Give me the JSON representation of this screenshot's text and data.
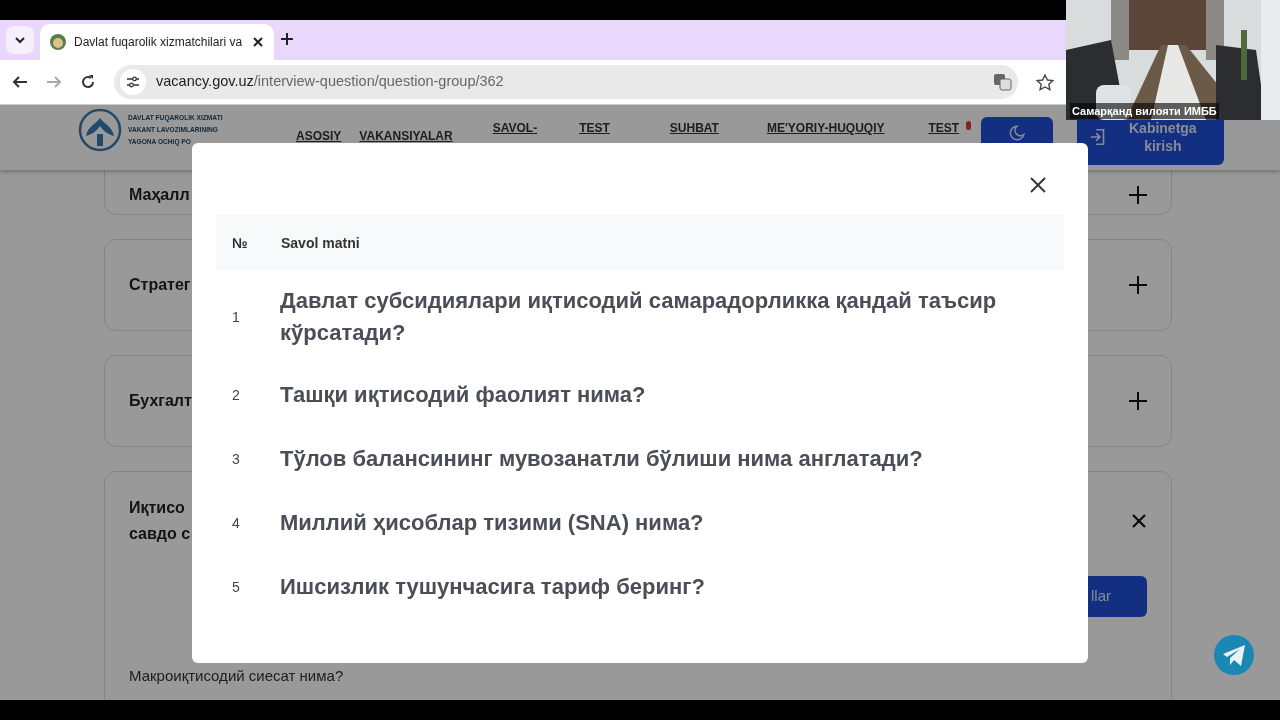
{
  "browser": {
    "tab_title": "Davlat fuqarolik xizmatchilari va",
    "url_host": "vacancy.gov.uz",
    "url_path": "/interview-question/question-group/362"
  },
  "site_header": {
    "logo_lines": [
      "DAVLAT FUQAROLIK XIZMATI",
      "VAKANT LAVOZIMLARINING",
      "YAGONA OCHIQ PO"
    ],
    "nav": [
      {
        "label": "ASOSIY",
        "alert": false
      },
      {
        "label": "VAKANSIYALAR",
        "alert": false
      },
      {
        "label": "SAVOL-",
        "alert": false
      },
      {
        "label": "TEST",
        "alert": false
      },
      {
        "label": "SUHBAT",
        "alert": false
      },
      {
        "label": "ME'YORIY-HUQUQIY",
        "alert": false
      },
      {
        "label": "TEST",
        "alert": true
      }
    ],
    "login_button": "Kabinetga kirish"
  },
  "background_cards": [
    {
      "title_lines": [
        "Маҳалл"
      ],
      "expanded": false
    },
    {
      "title_lines": [
        "Стратег"
      ],
      "expanded": false
    },
    {
      "title_lines": [
        "Бухгалт"
      ],
      "expanded": false
    },
    {
      "title_lines": [
        "Иқтисо",
        "савдо с"
      ],
      "expanded": true,
      "button": "llar",
      "question": "Макроиқтисодий сиесат нима?"
    }
  ],
  "modal": {
    "columns": [
      "№",
      "Savol matni"
    ],
    "rows": [
      {
        "number": "1",
        "question": "Давлат субсидиялари иқтисодий самарадорликка қандай таъсир кўрсатади?"
      },
      {
        "number": "2",
        "question": "Ташқи иқтисодий фаолият нима?"
      },
      {
        "number": "3",
        "question": "Тўлов балансининг мувозанатли бўлиши нима англатади?"
      },
      {
        "number": "4",
        "question": "Миллий ҳисоблар тизими (SNA) нима?"
      },
      {
        "number": "5",
        "question": "Ишсизлик тушунчасига тариф беринг?"
      }
    ]
  },
  "video_tile": {
    "label": "Самарқанд вилояти ИМББ"
  }
}
